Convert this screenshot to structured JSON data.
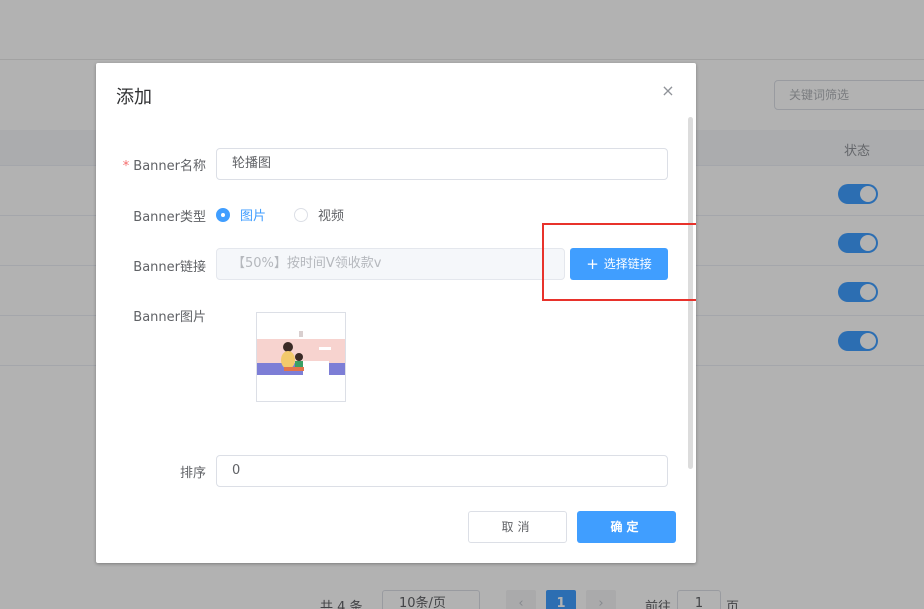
{
  "background": {
    "filter_placeholder": "关键词筛选",
    "table_header_status": "状态",
    "pagination": {
      "total": "共 4 条",
      "page_size": "10条/页",
      "current_page": "1",
      "goto_label": "前往",
      "goto_value": "1",
      "page_suffix": "页"
    }
  },
  "dialog": {
    "title": "添加",
    "close_icon": "×",
    "fields": {
      "name": {
        "label": "Banner名称",
        "required_mark": "*",
        "value": "轮播图"
      },
      "type": {
        "label": "Banner类型",
        "options": [
          {
            "label": "图片",
            "checked": true
          },
          {
            "label": "视频",
            "checked": false
          }
        ]
      },
      "link": {
        "label": "Banner链接",
        "value": "【50%】按时间V领收款v",
        "button_label": "选择链接",
        "button_icon": "+"
      },
      "image": {
        "label": "Banner图片"
      },
      "sort": {
        "label": "排序",
        "value": "0"
      }
    },
    "footer": {
      "cancel_label": "取消",
      "confirm_label": "确定"
    }
  },
  "colors": {
    "primary": "#409eff",
    "highlight": "#e8322b",
    "required": "#f56c6c"
  }
}
